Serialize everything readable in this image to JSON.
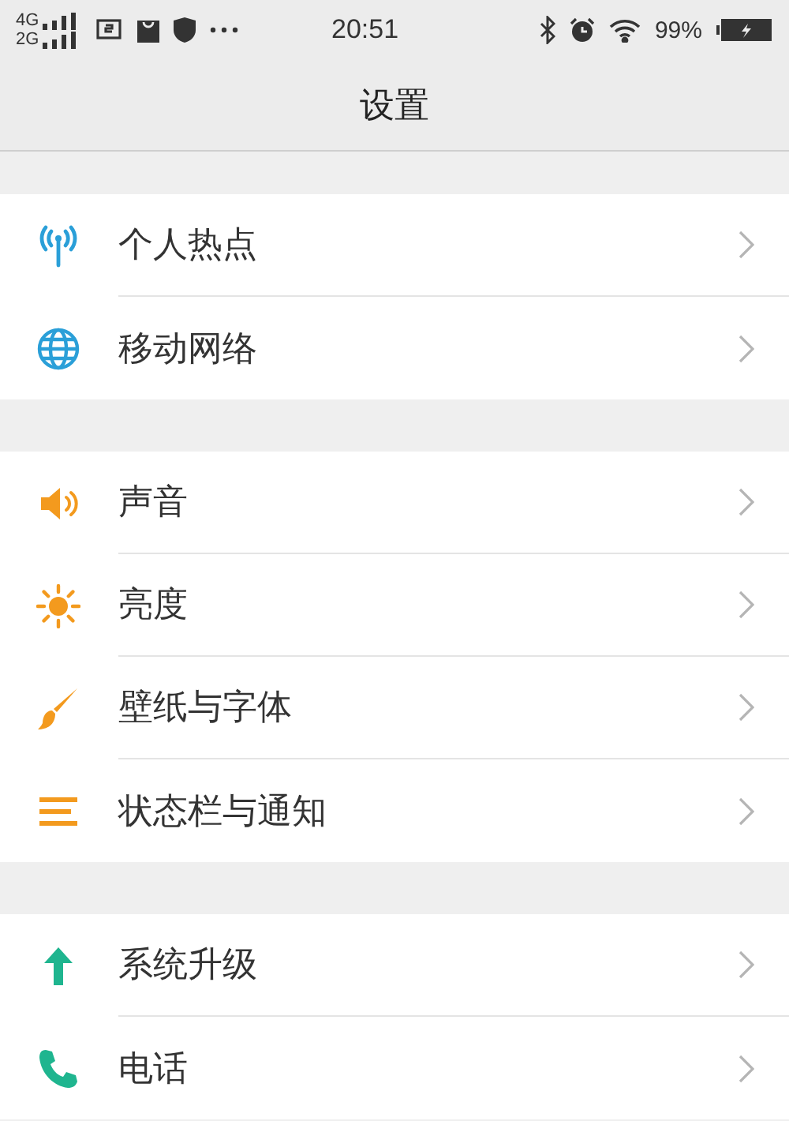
{
  "status_bar": {
    "networks": [
      "4G",
      "2G"
    ],
    "time": "20:51",
    "battery": "99%"
  },
  "header": {
    "title": "设置"
  },
  "groups": [
    {
      "items": [
        {
          "kind": "hotspot",
          "label": "个人热点"
        },
        {
          "kind": "globe",
          "label": "移动网络"
        }
      ]
    },
    {
      "items": [
        {
          "kind": "speaker",
          "label": "声音"
        },
        {
          "kind": "sun",
          "label": "亮度"
        },
        {
          "kind": "brush",
          "label": "壁纸与字体"
        },
        {
          "kind": "lines",
          "label": "状态栏与通知"
        }
      ]
    },
    {
      "items": [
        {
          "kind": "arrow",
          "label": "系统升级"
        },
        {
          "kind": "phone",
          "label": "电话"
        }
      ]
    }
  ]
}
